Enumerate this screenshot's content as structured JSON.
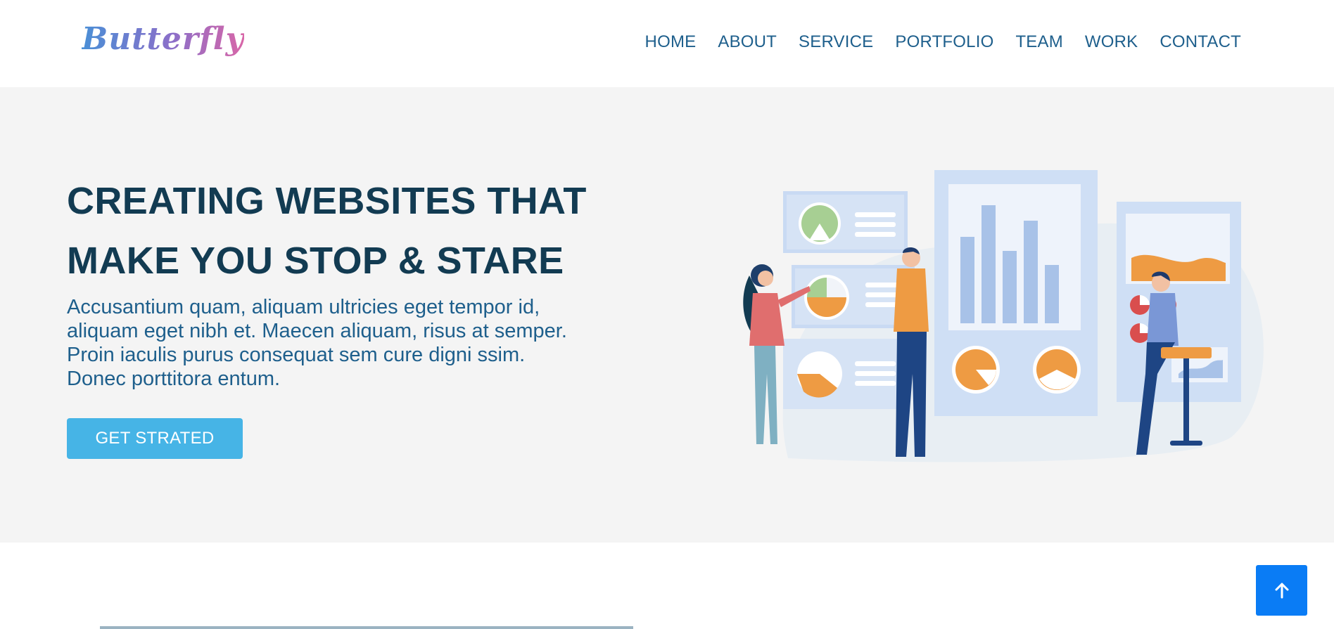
{
  "header": {
    "logo_text": "Butterfly",
    "nav": [
      "HOME",
      "ABOUT",
      "SERVICE",
      "PORTFOLIO",
      "TEAM",
      "WORK",
      "CONTACT"
    ]
  },
  "hero": {
    "title_lines": [
      "CREATING WEBSITES THAT",
      "MAKE YOU STOP & STARE"
    ],
    "description_lines": [
      "Accusantium quam, aliquam ultricies eget tempor id,",
      "aliquam eget nibh et. Maecen aliquam, risus at semper.",
      "Proin iaculis purus consequat sem cure digni ssim.",
      "Donec porttitora entum."
    ],
    "cta_label": "GET STRATED",
    "illustration": "business-analytics-illustration"
  },
  "back_to_top": {
    "icon": "arrow-up-icon"
  },
  "colors": {
    "nav_text": "#1e5f8c",
    "title": "#123b52",
    "cta": "#46b4e6",
    "back_to_top": "#0a7cf5",
    "hero_bg": "#f4f4f4"
  }
}
